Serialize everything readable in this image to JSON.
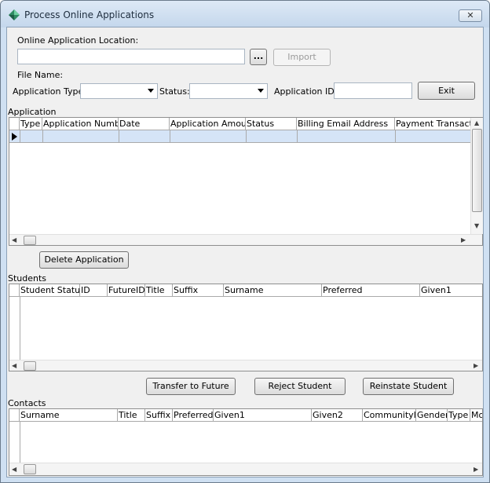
{
  "window": {
    "title": "Process Online Applications",
    "close_glyph": "✕"
  },
  "form": {
    "location_label": "Online Application Location:",
    "location_value": "",
    "browse_label": "...",
    "import_label": "Import",
    "file_name_label": "File Name:",
    "file_name_value": "",
    "app_type_label": "Application Type:",
    "app_type_value": "",
    "status_label": "Status:",
    "status_value": "",
    "app_id_label": "Application ID:",
    "app_id_value": "",
    "exit_label": "Exit"
  },
  "application": {
    "section_label": "Application",
    "columns": [
      "Type",
      "Application Number",
      "Date",
      "Application Amount",
      "Status",
      "Billing Email Address",
      "Payment Transactio"
    ],
    "rows": [],
    "delete_label": "Delete Application"
  },
  "students": {
    "section_label": "Students",
    "columns": [
      "Student Status",
      "ID",
      "FutureID",
      "Title",
      "Suffix",
      "Surname",
      "Preferred",
      "Given1"
    ],
    "rows": [],
    "transfer_label": "Transfer to Future",
    "reject_label": "Reject Student",
    "reinstate_label": "Reinstate Student"
  },
  "contacts": {
    "section_label": "Contacts",
    "columns": [
      "Surname",
      "Title",
      "Suffix",
      "Preferred",
      "Given1",
      "Given2",
      "CommunityID",
      "Gender",
      "Type",
      "Mo"
    ],
    "rows": []
  },
  "icons": {
    "app_icon": "diamond-app-icon",
    "close": "close-icon",
    "dropdown": "chevron-down-icon",
    "row_pointer": "row-pointer-icon"
  }
}
